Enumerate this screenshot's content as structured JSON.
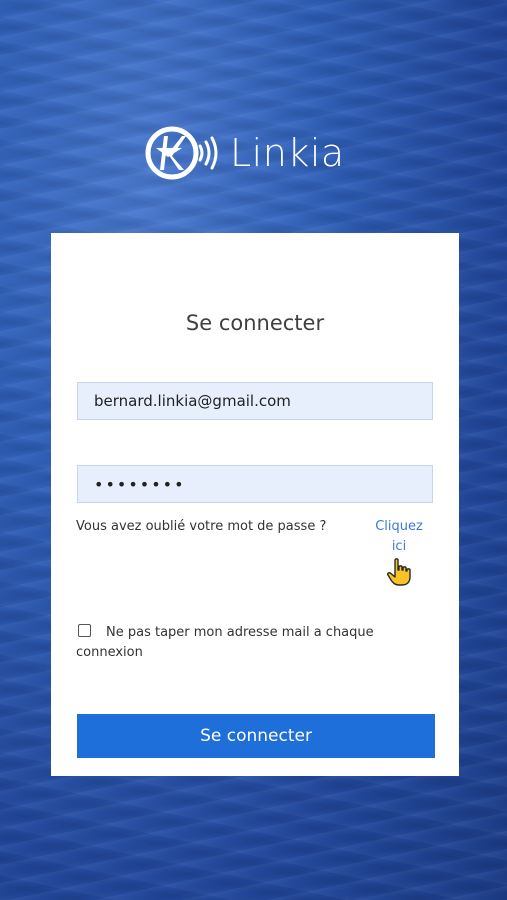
{
  "brand": {
    "name": "Linkia",
    "logo_icon": "linkia-k-wave-icon"
  },
  "login": {
    "title": "Se connecter",
    "email_value": "bernard.linkia@gmail.com",
    "password_value": "••••••••",
    "forgot_text": "Vous avez oublié votre mot de passe ?",
    "forgot_link": "Cliquez ici",
    "remember_label": "Ne pas taper mon adresse mail a chaque connexion",
    "remember_checked": false,
    "submit_label": "Se connecter",
    "cursor_icon": "pointing-hand-icon"
  },
  "colors": {
    "background": "#2f5fb8",
    "card": "#ffffff",
    "field_bg": "#e8effc",
    "link": "#3a7bd5",
    "button": "#1e6fd9"
  }
}
